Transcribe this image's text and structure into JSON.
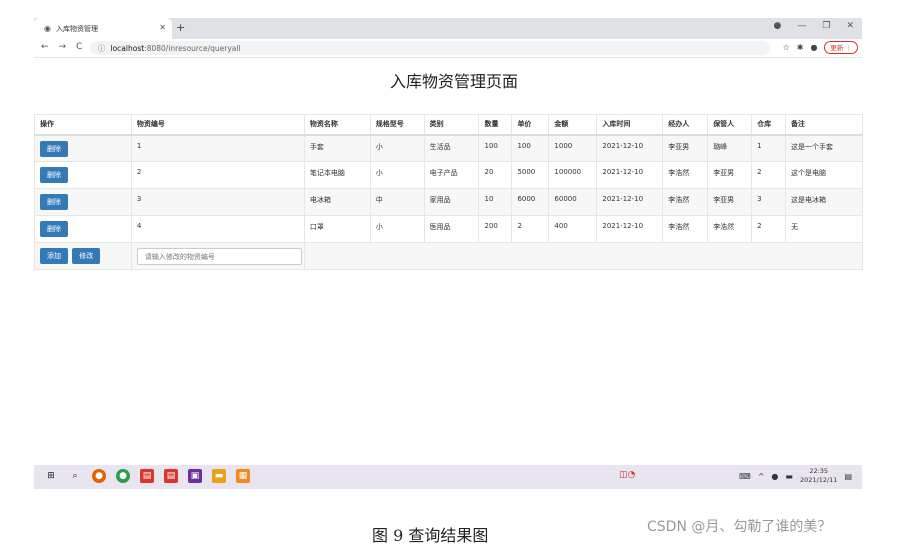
{
  "browser": {
    "tab_title": "入库物资管理",
    "url_host": "localhost",
    "url_path": ":8080/inresource/queryall",
    "update_label": "更新"
  },
  "page_title": "入库物资管理页面",
  "table": {
    "headers": [
      "操作",
      "物资编号",
      "物资名称",
      "规格型号",
      "类别",
      "数量",
      "单价",
      "金额",
      "入库时间",
      "经办人",
      "保管人",
      "仓库",
      "备注"
    ],
    "rows": [
      {
        "action": "删除",
        "id": "1",
        "name": "手套",
        "spec": "小",
        "category": "生活品",
        "qty": "100",
        "price": "100",
        "amount": "1000",
        "date": "2021-12-10",
        "handler": "李亚男",
        "keeper": "璐峰",
        "warehouse": "1",
        "note": "这是一个手套"
      },
      {
        "action": "删除",
        "id": "2",
        "name": "笔记本电脑",
        "spec": "小",
        "category": "电子产品",
        "qty": "20",
        "price": "5000",
        "amount": "100000",
        "date": "2021-12-10",
        "handler": "李浩然",
        "keeper": "李亚男",
        "warehouse": "2",
        "note": "这个是电脑"
      },
      {
        "action": "删除",
        "id": "3",
        "name": "电冰箱",
        "spec": "中",
        "category": "家用品",
        "qty": "10",
        "price": "6000",
        "amount": "60000",
        "date": "2021-12-10",
        "handler": "李浩然",
        "keeper": "李亚男",
        "warehouse": "3",
        "note": "这是电冰箱"
      },
      {
        "action": "删除",
        "id": "4",
        "name": "口罩",
        "spec": "小",
        "category": "医用品",
        "qty": "200",
        "price": "2",
        "amount": "400",
        "date": "2021-12-10",
        "handler": "李浩然",
        "keeper": "李浩然",
        "warehouse": "2",
        "note": "无"
      }
    ],
    "add_label": "添加",
    "edit_label": "修改",
    "input_placeholder": "请输入修改的物资编号"
  },
  "taskbar": {
    "time": "22:35",
    "date": "2021/12/11"
  },
  "caption": "图 9  查询结果图",
  "watermark": "CSDN @月、勾勒了谁的美？"
}
